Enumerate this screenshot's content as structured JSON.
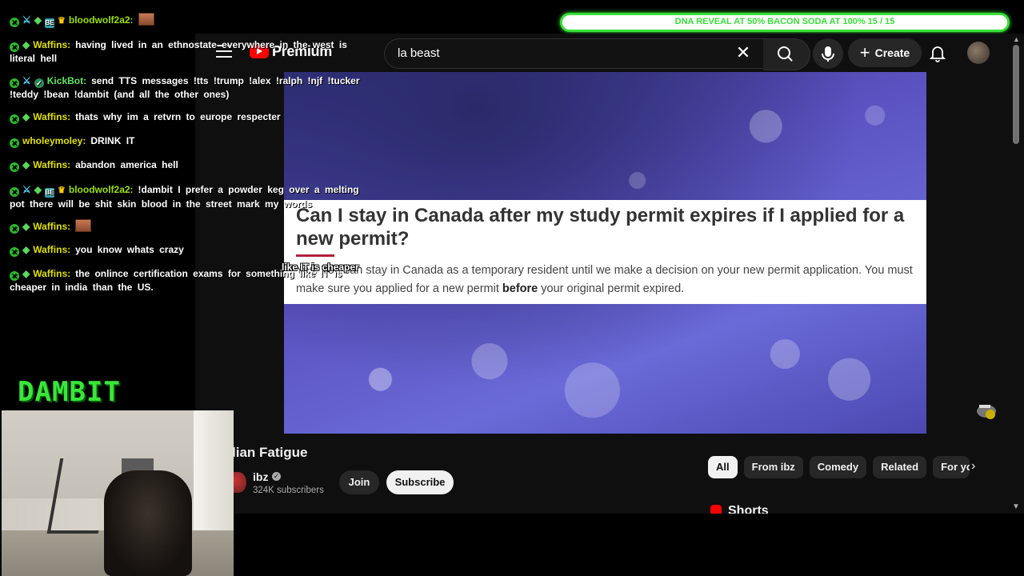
{
  "banner": {
    "text": "DNA REVEAL AT 50% BACON SODA AT 100% 15 / 15",
    "progress": 1.0
  },
  "youtube": {
    "logo_text": "Premium",
    "search": {
      "value": "la beast"
    },
    "create_label": "Create",
    "video": {
      "post_title": "Can I stay in Canada after my study permit expires if I applied for a new permit?",
      "post_body_1": "Yes. You can stay in Canada as a temporary resident until we make a decision on your new permit application. You must make sure you applied for a new permit ",
      "post_body_bold": "before",
      "post_body_2": " your original permit expired."
    },
    "video_title": "lian Fatigue",
    "channel": {
      "name": "ibz",
      "subscribers": "324K subscribers"
    },
    "join_label": "Join",
    "subscribe_label": "Subscribe",
    "chips": [
      "All",
      "From ibz",
      "Comedy",
      "Related",
      "For yo"
    ],
    "shorts_label": "Shorts"
  },
  "chat": [
    {
      "user": "bloodwolf2a2:",
      "badges": [
        "mod",
        "sword",
        "dia",
        "box",
        "crown"
      ],
      "text": "",
      "emote": true,
      "user_color": "#9be000"
    },
    {
      "user": "Waffins:",
      "badges": [
        "mod",
        "dia"
      ],
      "text": "having lived in an ethnostate everywhere in the west is literal hell",
      "emote": false,
      "user_color": "#e0e000"
    },
    {
      "user": "KickBot:",
      "badges": [
        "mod",
        "sword",
        "check"
      ],
      "text": "send TTS messages !tts !trump !alex !ralph !njf !tucker !teddy !bean !dambit (and all the other ones)",
      "emote": false,
      "user_color": "#5ee65e"
    },
    {
      "user": "Waffins:",
      "badges": [
        "mod",
        "dia"
      ],
      "text": "thats why im a retvrn to europe respecter",
      "emote": false,
      "user_color": "#e0e000"
    },
    {
      "user": "wholeymoley:",
      "badges": [
        "mod"
      ],
      "text": "DRINK IT",
      "emote": false,
      "user_color": "#e0e000"
    },
    {
      "user": "Waffins:",
      "badges": [
        "mod",
        "dia"
      ],
      "text": "abandon america hell",
      "emote": false,
      "user_color": "#e0e000"
    },
    {
      "user": "bloodwolf2a2:",
      "badges": [
        "mod",
        "sword",
        "dia",
        "box",
        "crown"
      ],
      "text": "!dambit I prefer a powder keg over a melting pot there will be shit skin blood in the street mark my words",
      "emote": false,
      "user_color": "#9be000"
    },
    {
      "user": "Waffins:",
      "badges": [
        "mod",
        "dia"
      ],
      "text": "",
      "emote": true,
      "user_color": "#e0e000"
    },
    {
      "user": "Waffins:",
      "badges": [
        "mod",
        "dia"
      ],
      "text": "you know whats crazy",
      "emote": false,
      "user_color": "#e0e000"
    },
    {
      "user": "Waffins:",
      "badges": [
        "mod",
        "dia"
      ],
      "text": "the onlince certification exams for something like IT is cheaper in india than the US.",
      "emote": false,
      "user_color": "#e0e000"
    }
  ],
  "overlay_caption": "like IT is cheaper",
  "stream_logo": "DAMBIT",
  "colors": {
    "accent_green": "#37e037",
    "yt_red": "#ff0000",
    "yt_bg": "#0f0f0f"
  }
}
